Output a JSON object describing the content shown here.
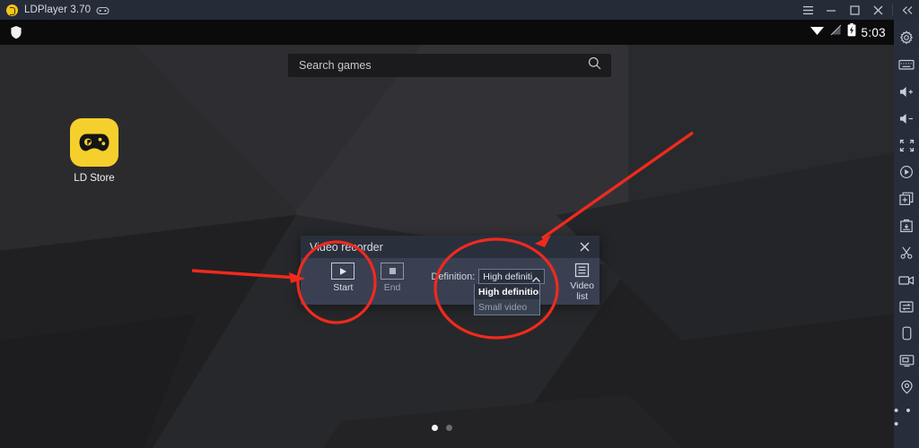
{
  "window": {
    "app_title": "LDPlayer 3.70",
    "logo_icon": "ldplayer-logo-icon",
    "gamepad_icon": "gamepad-icon",
    "controls": [
      {
        "name": "menu-button",
        "icon": "hamburger-menu-icon"
      },
      {
        "name": "minimize-button",
        "icon": "minimize-icon"
      },
      {
        "name": "maximize-button",
        "icon": "maximize-icon"
      },
      {
        "name": "close-button",
        "icon": "close-icon"
      },
      {
        "name": "collapse-button",
        "icon": "double-chevron-left-icon"
      }
    ]
  },
  "status_bar": {
    "shield_icon": "shield-icon",
    "wifi_icon": "wifi-icon",
    "signal_icon": "signal-off-icon",
    "battery_icon": "battery-charging-icon",
    "time": "5:03"
  },
  "search": {
    "placeholder": "Search games",
    "value": "",
    "icon": "search-icon"
  },
  "desktop": {
    "apps": [
      {
        "label": "LD Store",
        "icon": "gamepad-icon",
        "tile_color": "#f5cf2c"
      }
    ],
    "page_indicator": {
      "total": 2,
      "active": 1
    }
  },
  "dialog": {
    "title": "Video recorder",
    "close_icon": "close-icon",
    "start_button": {
      "label": "Start",
      "icon": "play-icon"
    },
    "end_button": {
      "label": "End",
      "icon": "stop-icon"
    },
    "definition": {
      "label": "Definition:",
      "selected": "High definition",
      "caret_icon": "chevron-up-icon",
      "options": [
        {
          "label": "High definition",
          "state": "selected"
        },
        {
          "label": "Small video",
          "state": "disabled"
        }
      ]
    },
    "video_list_button": {
      "label": "Video list",
      "icon": "list-icon"
    }
  },
  "toolbar": {
    "items": [
      {
        "name": "settings",
        "icon": "gear-icon"
      },
      {
        "name": "keyboard-mapping",
        "icon": "keyboard-icon"
      },
      {
        "name": "volume-up",
        "icon": "volume-up-icon"
      },
      {
        "name": "volume-down",
        "icon": "volume-down-icon"
      },
      {
        "name": "fullscreen",
        "icon": "fullscreen-icon"
      },
      {
        "name": "macro-record",
        "icon": "record-circle-icon"
      },
      {
        "name": "multi-instance",
        "icon": "copy-plus-icon"
      },
      {
        "name": "install-apk",
        "icon": "apk-install-icon"
      },
      {
        "name": "screenshot-cut",
        "icon": "scissors-icon"
      },
      {
        "name": "video-recorder",
        "icon": "video-camera-icon"
      },
      {
        "name": "file-transfer",
        "icon": "transfer-icon"
      },
      {
        "name": "shake",
        "icon": "phone-shake-icon"
      },
      {
        "name": "virtual-screen",
        "icon": "monitor-icon"
      },
      {
        "name": "virtual-location",
        "icon": "location-pin-icon"
      },
      {
        "name": "more",
        "icon": "more-dots-icon"
      }
    ],
    "more_label": "• • •"
  },
  "annotations": {
    "accent_color": "#ef2a1e",
    "shapes": [
      {
        "type": "ellipse",
        "target": "start-button"
      },
      {
        "type": "ellipse",
        "target": "definition-dropdown"
      },
      {
        "type": "arrow",
        "target": "start-button"
      },
      {
        "type": "arrow",
        "target": "dialog-header"
      }
    ]
  }
}
